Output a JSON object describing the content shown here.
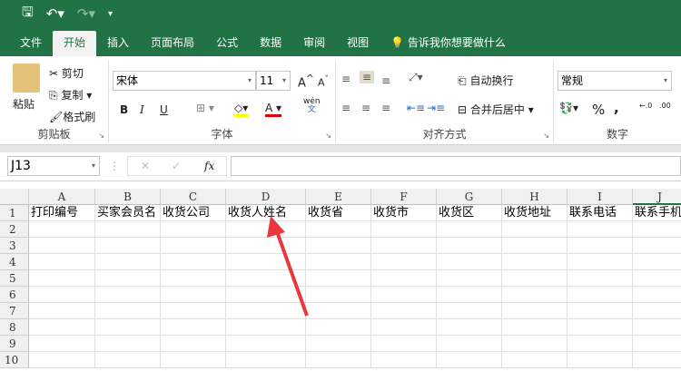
{
  "qat": {
    "save_icon": "save-icon",
    "undo_icon": "undo-icon",
    "redo_icon": "redo-icon",
    "customize_icon": "customize-icon"
  },
  "tabs": [
    {
      "label": "文件"
    },
    {
      "label": "开始",
      "active": true
    },
    {
      "label": "插入"
    },
    {
      "label": "页面布局"
    },
    {
      "label": "公式"
    },
    {
      "label": "数据"
    },
    {
      "label": "审阅"
    },
    {
      "label": "视图"
    }
  ],
  "tell_me": "告诉我你想要做什么",
  "clipboard": {
    "paste": "粘贴",
    "cut": "剪切",
    "copy": "复制",
    "format_painter": "格式刷",
    "label": "剪贴板"
  },
  "font": {
    "name": "宋体",
    "size": "11",
    "bold": "B",
    "italic": "I",
    "underline": "U",
    "phonetic": "wén",
    "phonetic_sub": "文",
    "label": "字体",
    "font_color": "#e00000",
    "fill_color": "#ffff00"
  },
  "alignment": {
    "wrap": "自动换行",
    "merge": "合并后居中",
    "label": "对齐方式"
  },
  "number": {
    "format": "常规",
    "percent": "%",
    "comma": ",",
    "label": "数字"
  },
  "formula_bar": {
    "name_box": "J13",
    "cancel": "✕",
    "enter": "✓",
    "fx": "fx",
    "value": ""
  },
  "columns": [
    "A",
    "B",
    "C",
    "D",
    "E",
    "F",
    "G",
    "H",
    "I",
    "J"
  ],
  "rows": [
    "1",
    "2",
    "3",
    "4",
    "5",
    "6",
    "7",
    "8",
    "9",
    "10"
  ],
  "row1": [
    "打印编号",
    "买家会员名",
    "收货公司",
    "收货人姓名",
    "收货省",
    "收货市",
    "收货区",
    "收货地址",
    "联系电话",
    "联系手机"
  ],
  "annotation": {
    "arrow_color": "#e8383d"
  }
}
